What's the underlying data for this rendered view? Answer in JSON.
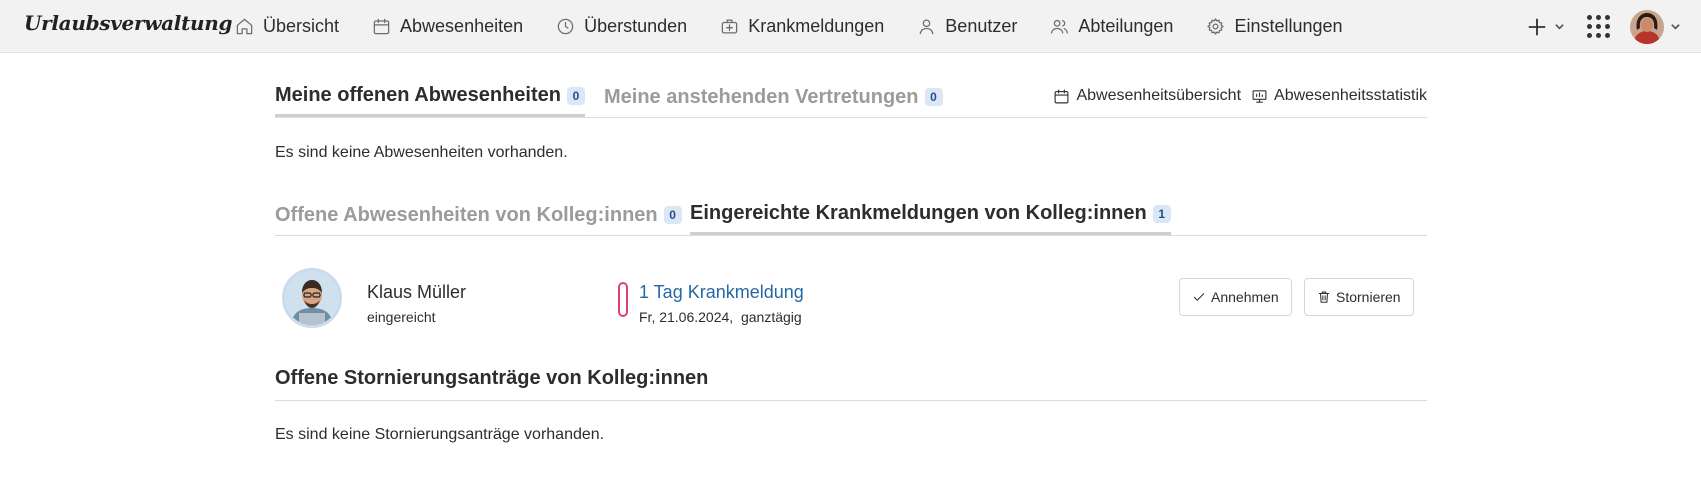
{
  "app": {
    "brand": "Urlaubsverwaltung"
  },
  "nav": {
    "items": [
      {
        "label": "Übersicht",
        "icon": "home-icon"
      },
      {
        "label": "Abwesenheiten",
        "icon": "calendar-icon"
      },
      {
        "label": "Überstunden",
        "icon": "clock-icon"
      },
      {
        "label": "Krankmeldungen",
        "icon": "medical-case-icon"
      },
      {
        "label": "Benutzer",
        "icon": "user-icon"
      },
      {
        "label": "Abteilungen",
        "icon": "users-icon"
      },
      {
        "label": "Einstellungen",
        "icon": "gear-icon"
      }
    ]
  },
  "tabs1": {
    "active_label": "Meine offenen Abwesenheiten",
    "active_count": "0",
    "inactive_label": "Meine anstehenden Vertretungen",
    "inactive_count": "0",
    "link_overview": "Abwesenheitsübersicht",
    "link_stats": "Abwesenheitsstatistik",
    "empty": "Es sind keine Abwesenheiten vorhanden."
  },
  "tabs2": {
    "inactive_label": "Offene Abwesenheiten von Kolleg:innen",
    "inactive_count": "0",
    "active_label": "Eingereichte Krankmeldungen von Kolleg:innen",
    "active_count": "1"
  },
  "sick_note": {
    "name": "Klaus Müller",
    "status": "eingereicht",
    "title": "1 Tag Krankmeldung",
    "date": "Fr, 21.06.2024,  ganztägig",
    "accept_label": "Annehmen",
    "cancel_label": "Stornieren",
    "accent_color": "#e0407a"
  },
  "cancellations": {
    "title": "Offene Stornierungsanträge von Kolleg:innen",
    "empty": "Es sind keine Stornierungsanträge vorhanden."
  },
  "colors": {
    "link": "#2767a6",
    "badge_bg": "#dbe7f7",
    "badge_text": "#1f4e8c"
  }
}
